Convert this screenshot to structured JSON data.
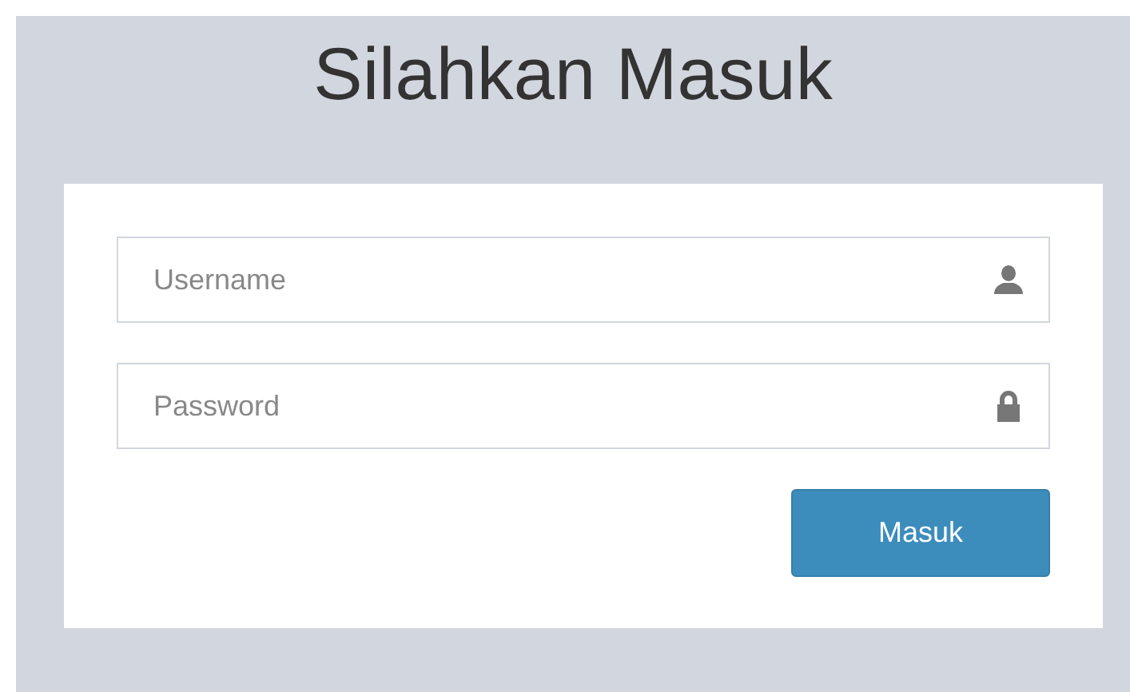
{
  "title": "Silahkan Masuk",
  "fields": [
    {
      "placeholder": "Username",
      "kind": "user"
    },
    {
      "placeholder": "Password",
      "kind": "lock"
    }
  ],
  "button": "Masuk"
}
